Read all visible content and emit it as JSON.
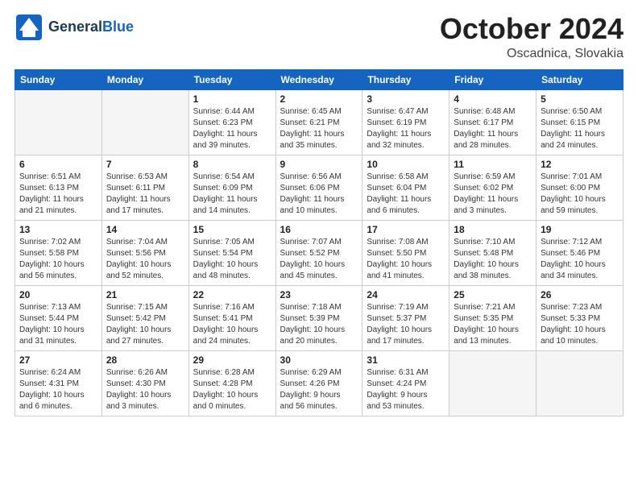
{
  "header": {
    "logo_general": "General",
    "logo_blue": "Blue",
    "title": "October 2024",
    "subtitle": "Oscadnica, Slovakia"
  },
  "days_of_week": [
    "Sunday",
    "Monday",
    "Tuesday",
    "Wednesday",
    "Thursday",
    "Friday",
    "Saturday"
  ],
  "weeks": [
    [
      {
        "day": "",
        "info": ""
      },
      {
        "day": "",
        "info": ""
      },
      {
        "day": "1",
        "info": "Sunrise: 6:44 AM\nSunset: 6:23 PM\nDaylight: 11 hours\nand 39 minutes."
      },
      {
        "day": "2",
        "info": "Sunrise: 6:45 AM\nSunset: 6:21 PM\nDaylight: 11 hours\nand 35 minutes."
      },
      {
        "day": "3",
        "info": "Sunrise: 6:47 AM\nSunset: 6:19 PM\nDaylight: 11 hours\nand 32 minutes."
      },
      {
        "day": "4",
        "info": "Sunrise: 6:48 AM\nSunset: 6:17 PM\nDaylight: 11 hours\nand 28 minutes."
      },
      {
        "day": "5",
        "info": "Sunrise: 6:50 AM\nSunset: 6:15 PM\nDaylight: 11 hours\nand 24 minutes."
      }
    ],
    [
      {
        "day": "6",
        "info": "Sunrise: 6:51 AM\nSunset: 6:13 PM\nDaylight: 11 hours\nand 21 minutes."
      },
      {
        "day": "7",
        "info": "Sunrise: 6:53 AM\nSunset: 6:11 PM\nDaylight: 11 hours\nand 17 minutes."
      },
      {
        "day": "8",
        "info": "Sunrise: 6:54 AM\nSunset: 6:09 PM\nDaylight: 11 hours\nand 14 minutes."
      },
      {
        "day": "9",
        "info": "Sunrise: 6:56 AM\nSunset: 6:06 PM\nDaylight: 11 hours\nand 10 minutes."
      },
      {
        "day": "10",
        "info": "Sunrise: 6:58 AM\nSunset: 6:04 PM\nDaylight: 11 hours\nand 6 minutes."
      },
      {
        "day": "11",
        "info": "Sunrise: 6:59 AM\nSunset: 6:02 PM\nDaylight: 11 hours\nand 3 minutes."
      },
      {
        "day": "12",
        "info": "Sunrise: 7:01 AM\nSunset: 6:00 PM\nDaylight: 10 hours\nand 59 minutes."
      }
    ],
    [
      {
        "day": "13",
        "info": "Sunrise: 7:02 AM\nSunset: 5:58 PM\nDaylight: 10 hours\nand 56 minutes."
      },
      {
        "day": "14",
        "info": "Sunrise: 7:04 AM\nSunset: 5:56 PM\nDaylight: 10 hours\nand 52 minutes."
      },
      {
        "day": "15",
        "info": "Sunrise: 7:05 AM\nSunset: 5:54 PM\nDaylight: 10 hours\nand 48 minutes."
      },
      {
        "day": "16",
        "info": "Sunrise: 7:07 AM\nSunset: 5:52 PM\nDaylight: 10 hours\nand 45 minutes."
      },
      {
        "day": "17",
        "info": "Sunrise: 7:08 AM\nSunset: 5:50 PM\nDaylight: 10 hours\nand 41 minutes."
      },
      {
        "day": "18",
        "info": "Sunrise: 7:10 AM\nSunset: 5:48 PM\nDaylight: 10 hours\nand 38 minutes."
      },
      {
        "day": "19",
        "info": "Sunrise: 7:12 AM\nSunset: 5:46 PM\nDaylight: 10 hours\nand 34 minutes."
      }
    ],
    [
      {
        "day": "20",
        "info": "Sunrise: 7:13 AM\nSunset: 5:44 PM\nDaylight: 10 hours\nand 31 minutes."
      },
      {
        "day": "21",
        "info": "Sunrise: 7:15 AM\nSunset: 5:42 PM\nDaylight: 10 hours\nand 27 minutes."
      },
      {
        "day": "22",
        "info": "Sunrise: 7:16 AM\nSunset: 5:41 PM\nDaylight: 10 hours\nand 24 minutes."
      },
      {
        "day": "23",
        "info": "Sunrise: 7:18 AM\nSunset: 5:39 PM\nDaylight: 10 hours\nand 20 minutes."
      },
      {
        "day": "24",
        "info": "Sunrise: 7:19 AM\nSunset: 5:37 PM\nDaylight: 10 hours\nand 17 minutes."
      },
      {
        "day": "25",
        "info": "Sunrise: 7:21 AM\nSunset: 5:35 PM\nDaylight: 10 hours\nand 13 minutes."
      },
      {
        "day": "26",
        "info": "Sunrise: 7:23 AM\nSunset: 5:33 PM\nDaylight: 10 hours\nand 10 minutes."
      }
    ],
    [
      {
        "day": "27",
        "info": "Sunrise: 6:24 AM\nSunset: 4:31 PM\nDaylight: 10 hours\nand 6 minutes."
      },
      {
        "day": "28",
        "info": "Sunrise: 6:26 AM\nSunset: 4:30 PM\nDaylight: 10 hours\nand 3 minutes."
      },
      {
        "day": "29",
        "info": "Sunrise: 6:28 AM\nSunset: 4:28 PM\nDaylight: 10 hours\nand 0 minutes."
      },
      {
        "day": "30",
        "info": "Sunrise: 6:29 AM\nSunset: 4:26 PM\nDaylight: 9 hours\nand 56 minutes."
      },
      {
        "day": "31",
        "info": "Sunrise: 6:31 AM\nSunset: 4:24 PM\nDaylight: 9 hours\nand 53 minutes."
      },
      {
        "day": "",
        "info": ""
      },
      {
        "day": "",
        "info": ""
      }
    ]
  ]
}
